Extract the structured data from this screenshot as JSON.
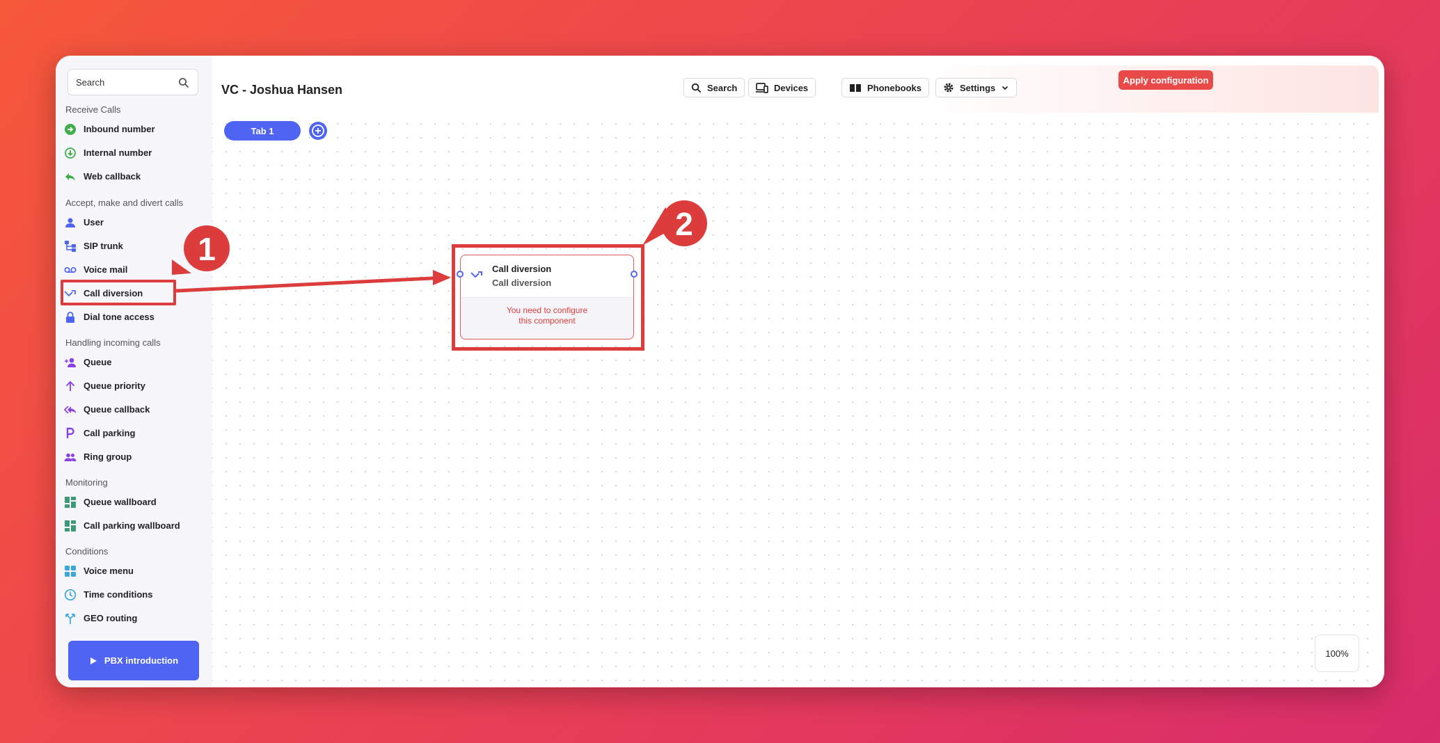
{
  "sidebar": {
    "search_placeholder": "Search",
    "sections": [
      {
        "title": "Receive Calls",
        "items": [
          {
            "label": "Inbound number",
            "icon": "inbound-arrow-icon"
          },
          {
            "label": "Internal number",
            "icon": "internal-download-icon"
          },
          {
            "label": "Web callback",
            "icon": "reply-arrow-icon"
          }
        ]
      },
      {
        "title": "Accept, make and divert calls",
        "items": [
          {
            "label": "User",
            "icon": "user-icon"
          },
          {
            "label": "SIP trunk",
            "icon": "sip-trunk-icon"
          },
          {
            "label": "Voice mail",
            "icon": "voicemail-icon"
          },
          {
            "label": "Call diversion",
            "icon": "call-diversion-icon"
          },
          {
            "label": "Dial tone access",
            "icon": "lock-icon"
          }
        ]
      },
      {
        "title": "Handling incoming calls",
        "items": [
          {
            "label": "Queue",
            "icon": "person-add-icon"
          },
          {
            "label": "Queue priority",
            "icon": "arrow-up-icon"
          },
          {
            "label": "Queue callback",
            "icon": "reply-all-icon"
          },
          {
            "label": "Call parking",
            "icon": "parking-p-icon"
          },
          {
            "label": "Ring group",
            "icon": "group-icon"
          }
        ]
      },
      {
        "title": "Monitoring",
        "items": [
          {
            "label": "Queue wallboard",
            "icon": "dashboard-icon"
          },
          {
            "label": "Call parking wallboard",
            "icon": "dashboard-icon"
          }
        ]
      },
      {
        "title": "Conditions",
        "items": [
          {
            "label": "Voice menu",
            "icon": "grid-icon"
          },
          {
            "label": "Time conditions",
            "icon": "clock-icon"
          },
          {
            "label": "GEO routing",
            "icon": "fork-icon"
          }
        ]
      }
    ],
    "pbx_button": "PBX introduction"
  },
  "header": {
    "title": "VC - Joshua Hansen",
    "search": "Search",
    "devices": "Devices",
    "phonebooks": "Phonebooks",
    "settings": "Settings",
    "apply": "Apply configuration"
  },
  "tabs": [
    {
      "label": "Tab 1"
    }
  ],
  "node": {
    "title": "Call diversion",
    "subtitle": "Call diversion",
    "warning_line1": "You need to configure",
    "warning_line2": "this component"
  },
  "zoom": "100%",
  "annotations": {
    "callout1": "1",
    "callout2": "2"
  },
  "colors": {
    "accent": "#4f64f3",
    "danger": "#e84a4a",
    "highlight": "#dc3c3c"
  }
}
